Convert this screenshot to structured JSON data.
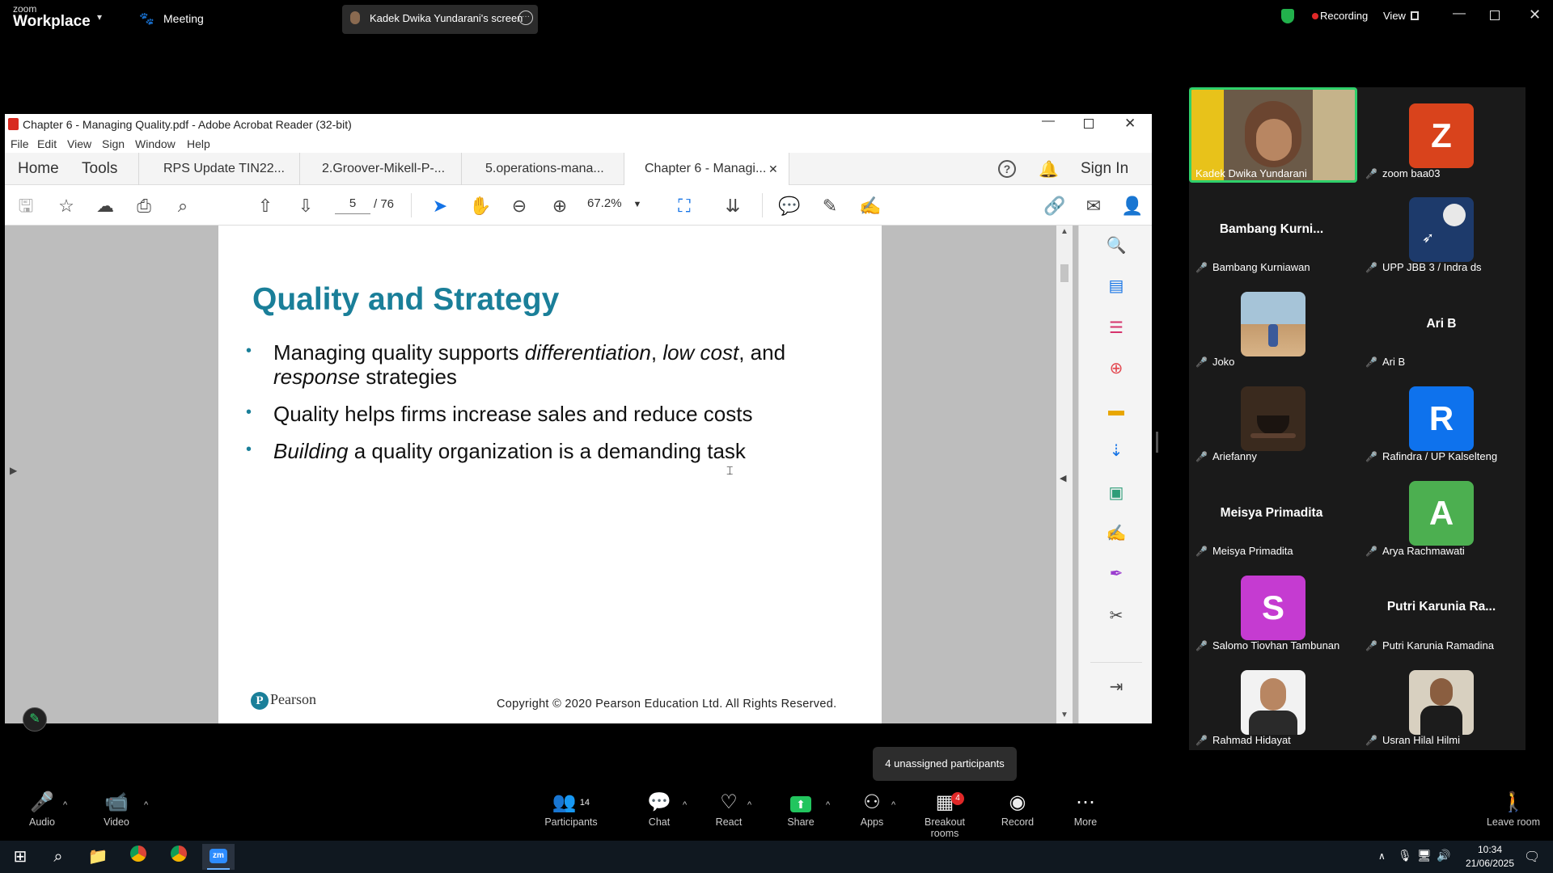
{
  "zoom": {
    "logo_small": "zoom",
    "logo_big": "Workplace",
    "meeting_label": "Meeting",
    "share_tab_label": "Kadek Dwika Yundarani's screen",
    "recording_label": "Recording",
    "view_label": "View"
  },
  "acrobat": {
    "title": "Chapter 6 - Managing Quality.pdf - Adobe Acrobat Reader (32-bit)",
    "menu": [
      "File",
      "Edit",
      "View",
      "Sign",
      "Window",
      "Help"
    ],
    "home_tab": "Home",
    "tools_tab": "Tools",
    "tabs": [
      "RPS Update TIN22...",
      "2.Groover-Mikell-P-...",
      "5.operations-mana...",
      "Chapter 6 - Managi..."
    ],
    "sign_in": "Sign In",
    "page_current": "5",
    "page_total": "/ 76",
    "zoom_value": "67.2%"
  },
  "slide": {
    "title": "Quality and Strategy",
    "bullet1_a": "Managing quality supports ",
    "bullet1_b": "differentiation",
    "bullet1_c": ", ",
    "bullet1_d": "low cost",
    "bullet1_e": ", and",
    "bullet1_f": "response",
    "bullet1_g": " strategies",
    "bullet2": "Quality helps firms increase sales and reduce costs",
    "bullet3_a": "Building",
    "bullet3_b": " a quality organization is a demanding task",
    "publisher": "Pearson",
    "copyright": "Copyright © 2020 Pearson Education Ltd. All Rights Reserved."
  },
  "participants": [
    {
      "name": "Kadek Dwika Yundarani"
    },
    {
      "name": "zoom baa03",
      "initial": "Z",
      "color": "#d9431c"
    },
    {
      "name": "Bambang Kurniawan",
      "display": "Bambang  Kurni..."
    },
    {
      "name": "UPP JBB 3 / Indra ds"
    },
    {
      "name": "Joko"
    },
    {
      "name": "Ari B",
      "display": "Ari B"
    },
    {
      "name": "Ariefanny"
    },
    {
      "name": "Rafindra / UP Kalselteng",
      "initial": "R",
      "color": "#0e72ed"
    },
    {
      "name": "Meisya Primadita",
      "display": "Meisya Primadita"
    },
    {
      "name": "Arya Rachmawati",
      "initial": "A",
      "color": "#4caf50"
    },
    {
      "name": "Salomo Tiovhan Tambunan",
      "initial": "S",
      "color": "#c53bd1"
    },
    {
      "name": "Putri Karunia Ramadina",
      "display": "Putri  Karunia  Ra..."
    },
    {
      "name": "Rahmad Hidayat"
    },
    {
      "name": "Usran Hilal Hilmi"
    }
  ],
  "tooltip": "4 unassigned participants",
  "bottom": {
    "audio": "Audio",
    "video": "Video",
    "participants": "Participants",
    "participants_count": "14",
    "chat": "Chat",
    "react": "React",
    "share": "Share",
    "apps": "Apps",
    "breakout": "Breakout rooms",
    "breakout_badge": "4",
    "record": "Record",
    "more": "More",
    "leave": "Leave room"
  },
  "taskbar": {
    "time": "10:34",
    "date": "21/06/2025"
  }
}
